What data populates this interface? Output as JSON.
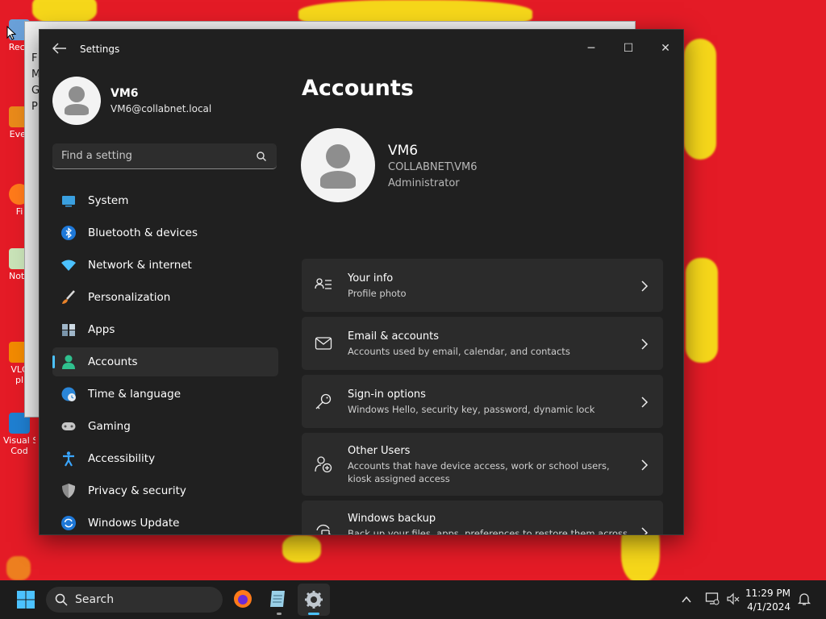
{
  "desktop": {
    "icons": [
      {
        "label": "Recy",
        "icon": "recycle-bin-icon"
      },
      {
        "label": "Ever",
        "icon": "everything-shortcut-icon"
      },
      {
        "label": "Fi",
        "icon": "firefox-shortcut-icon"
      },
      {
        "label": "Note",
        "icon": "notepad-shortcut-icon"
      },
      {
        "label": "VLC",
        "label2": "pl",
        "icon": "vlc-shortcut-icon"
      },
      {
        "label": "Visual St",
        "label2": "Cod",
        "icon": "vscode-shortcut-icon"
      }
    ],
    "bg_window_fragments": [
      "F",
      "M",
      "G",
      "P"
    ]
  },
  "window": {
    "title": "Settings",
    "controls": {
      "minimize": "─",
      "maximize": "☐",
      "close": "✕"
    }
  },
  "sidebar": {
    "profile": {
      "name": "VM6",
      "email": "VM6@collabnet.local"
    },
    "search_placeholder": "Find a setting",
    "items": [
      {
        "label": "System",
        "icon": "system-icon",
        "selected": false
      },
      {
        "label": "Bluetooth & devices",
        "icon": "bluetooth-icon",
        "selected": false
      },
      {
        "label": "Network & internet",
        "icon": "wifi-icon",
        "selected": false
      },
      {
        "label": "Personalization",
        "icon": "brush-icon",
        "selected": false
      },
      {
        "label": "Apps",
        "icon": "apps-icon",
        "selected": false
      },
      {
        "label": "Accounts",
        "icon": "accounts-icon",
        "selected": true
      },
      {
        "label": "Time & language",
        "icon": "globe-clock-icon",
        "selected": false
      },
      {
        "label": "Gaming",
        "icon": "gamepad-icon",
        "selected": false
      },
      {
        "label": "Accessibility",
        "icon": "accessibility-icon",
        "selected": false
      },
      {
        "label": "Privacy & security",
        "icon": "shield-icon",
        "selected": false
      },
      {
        "label": "Windows Update",
        "icon": "update-icon",
        "selected": false
      }
    ]
  },
  "main": {
    "title": "Accounts",
    "user": {
      "name": "VM6",
      "domain": "COLLABNET\\VM6",
      "role": "Administrator"
    },
    "cards": [
      {
        "title": "Your info",
        "subtitle": "Profile photo",
        "icon": "person-list-icon"
      },
      {
        "title": "Email & accounts",
        "subtitle": "Accounts used by email, calendar, and contacts",
        "icon": "mail-icon"
      },
      {
        "title": "Sign-in options",
        "subtitle": "Windows Hello, security key, password, dynamic lock",
        "icon": "key-icon"
      },
      {
        "title": "Other Users",
        "subtitle": "Accounts that have device access, work or school users, kiosk assigned access",
        "icon": "person-add-icon"
      },
      {
        "title": "Windows backup",
        "subtitle": "Back up your files, apps, preferences to restore them across devices",
        "icon": "backup-icon"
      }
    ]
  },
  "taskbar": {
    "search_label": "Search",
    "time": "11:29 PM",
    "date": "4/1/2024"
  },
  "colors": {
    "accent": "#4cc2ff",
    "wallpaper_red": "#e41b26",
    "wallpaper_yellow": "#f7e21a"
  }
}
